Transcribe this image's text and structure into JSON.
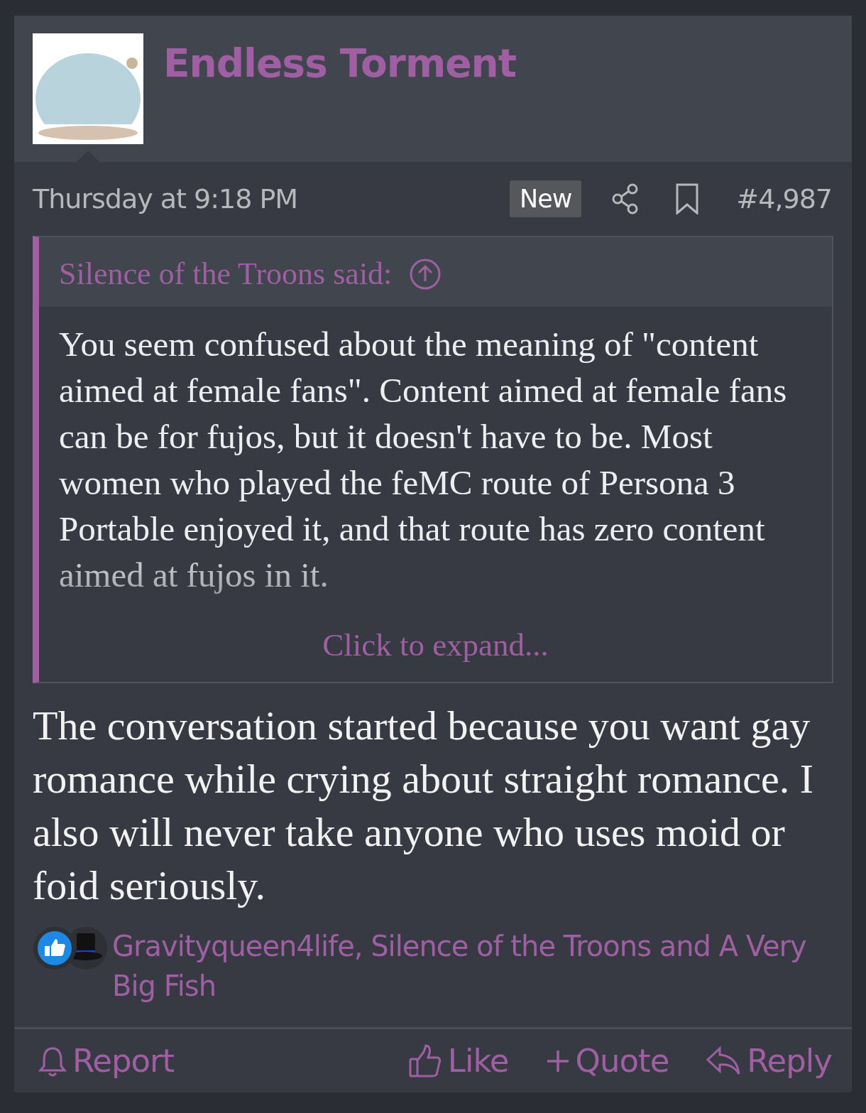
{
  "post": {
    "author": "Endless Torment",
    "date": "Thursday at 9:18 PM",
    "badge": "New",
    "number": "#4,987",
    "quote": {
      "author": "Silence of the Troons said:",
      "text": "You seem confused about the meaning of \"content aimed at female fans\". Content aimed at female fans can be for fujos, but it doesn't have to be. Most women who played the feMC route of Persona 3 Portable enjoyed it, and that route has zero content aimed at fujos in it.",
      "expand": "Click to expand..."
    },
    "body": "The conversation started because you want gay romance while crying about straight romance. I also will never take anyone who uses moid or foid seriously.",
    "reactions": "Gravityqueen4life, Silence of the Troons and A Very Big Fish",
    "actions": [
      {
        "kind": "report",
        "label": "Report"
      },
      {
        "kind": "like",
        "label": "Like"
      },
      {
        "kind": "quote",
        "label": "Quote"
      },
      {
        "kind": "reply",
        "label": "Reply"
      }
    ]
  }
}
